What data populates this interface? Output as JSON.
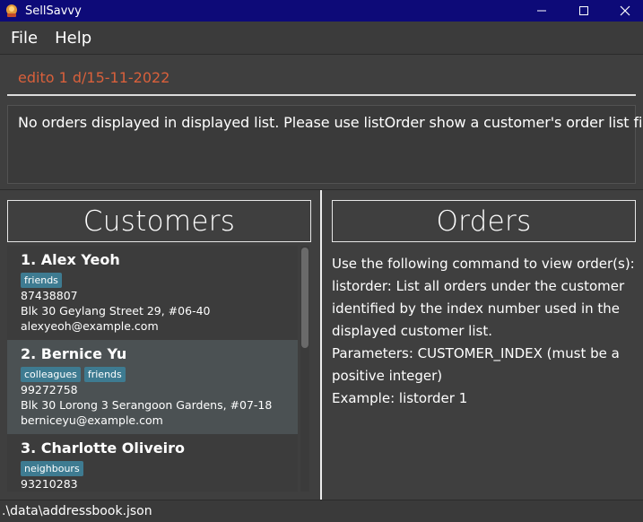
{
  "window": {
    "title": "SellSavvy"
  },
  "menu": [
    {
      "label": "File"
    },
    {
      "label": "Help"
    }
  ],
  "command": {
    "value": "edito 1 d/15-11-2022"
  },
  "result": {
    "message": "No orders displayed in displayed list. Please use listOrder show a customer's order list first!"
  },
  "customers_panel": {
    "title": "Customers",
    "customers": [
      {
        "name": "1. Alex Yeoh",
        "tags": [
          "friends"
        ],
        "phone": "87438807",
        "address": "Blk 30 Geylang Street 29, #06-40",
        "email": "alexyeoh@example.com"
      },
      {
        "name": "2. Bernice Yu",
        "tags": [
          "colleagues",
          "friends"
        ],
        "phone": "99272758",
        "address": "Blk 30 Lorong 3 Serangoon Gardens, #07-18",
        "email": "berniceyu@example.com"
      },
      {
        "name": "3. Charlotte Oliveiro",
        "tags": [
          "neighbours"
        ],
        "phone": "93210283",
        "address": "",
        "email": ""
      }
    ]
  },
  "orders_panel": {
    "title": "Orders",
    "help_lines": [
      "Use the following command to view order(s):",
      "listorder: List all orders under the customer",
      "identified by the index number used in the",
      "displayed customer list.",
      "Parameters: CUSTOMER_INDEX (must be a",
      "positive integer)",
      "Example: listorder 1"
    ]
  },
  "status": {
    "path": ".\\data\\addressbook.json"
  },
  "icons": {
    "app": "app-icon",
    "minimize": "minimize-icon",
    "maximize": "maximize-icon",
    "close": "close-icon"
  },
  "colors": {
    "titlebar": "#0d0a78",
    "command_text": "#d9603b",
    "tag": "#3e7b91",
    "selected_row": "#4b5153"
  }
}
